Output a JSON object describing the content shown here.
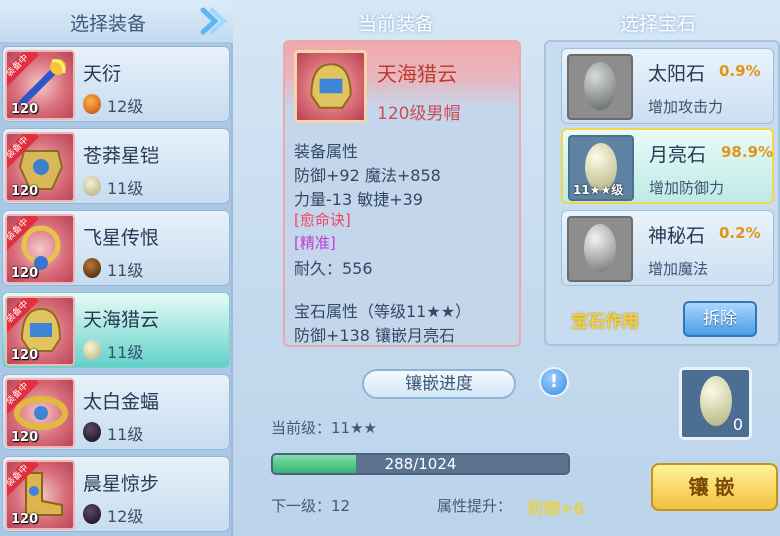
{
  "left": {
    "title": "选择装备",
    "items": [
      {
        "name": "天衍",
        "level": "12级",
        "icon_level": "120",
        "badge": "装备中",
        "gem_color": "#d96a1e"
      },
      {
        "name": "苍莽星铠",
        "level": "11级",
        "icon_level": "120",
        "badge": "装备中",
        "gem_color": "#cfc99a"
      },
      {
        "name": "飞星传恨",
        "level": "11级",
        "icon_level": "120",
        "badge": "装备中",
        "gem_color": "#6b3b14"
      },
      {
        "name": "天海猎云",
        "level": "11级",
        "icon_level": "120",
        "badge": "装备中",
        "gem_color": "#d7d6a3"
      },
      {
        "name": "太白金蝠",
        "level": "11级",
        "icon_level": "120",
        "badge": "装备中",
        "gem_color": "#2b1e2e"
      },
      {
        "name": "晨星惊步",
        "level": "12级",
        "icon_level": "120",
        "badge": "装备中",
        "gem_color": "#2b1e2e"
      }
    ]
  },
  "center": {
    "title": "当前装备",
    "item_name": "天海猎云",
    "item_sub": "120级男帽",
    "attr_header": "装备属性",
    "attr_line1": "防御+92 魔法+858",
    "attr_line2": "力量-13 敏捷+39",
    "special1": "[愈命诀]",
    "special2": "[精准]",
    "durability": "耐久：556",
    "gem_header": "宝石属性（等级11★★）",
    "gem_line": "防御+138 镶嵌月亮石",
    "progress_title": "镶嵌进度",
    "hint_icon": "!",
    "current_level": "当前级：11★★",
    "progress_text": "288/1024",
    "progress_current": 288,
    "progress_max": 1024,
    "next_level": "下一级：12",
    "boost_label": "属性提升：",
    "boost_value": "防御+6"
  },
  "right": {
    "title": "选择宝石",
    "gems": [
      {
        "name": "太阳石",
        "pct": "0.9%",
        "desc": "增加攻击力",
        "lv": "",
        "color": "#8f9390"
      },
      {
        "name": "月亮石",
        "pct": "98.9%",
        "desc": "增加防御力",
        "lv": "11★★级",
        "color": "#d9dbab"
      },
      {
        "name": "神秘石",
        "pct": "0.2%",
        "desc": "增加魔法",
        "lv": "",
        "color": "#9ea0a2"
      }
    ],
    "gem_function": "宝石作用",
    "remove_button": "拆除",
    "slot_count": "0",
    "inlay_button": "镶嵌"
  }
}
